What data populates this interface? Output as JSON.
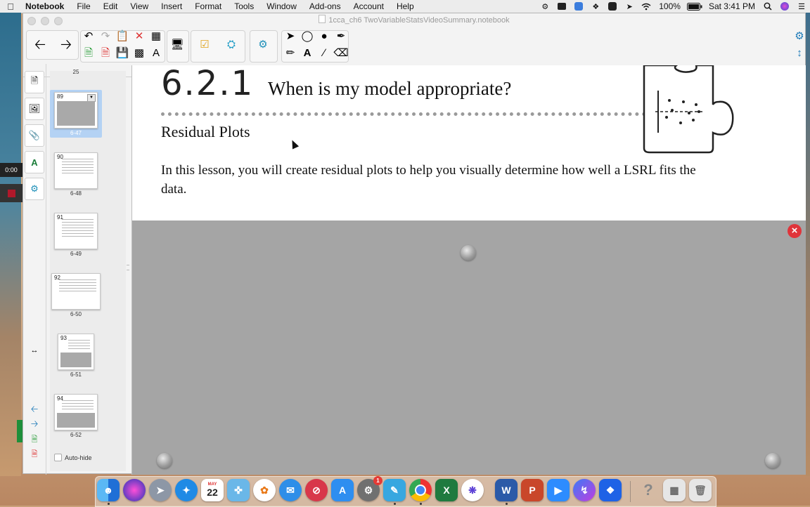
{
  "menubar": {
    "app_name": "Notebook",
    "items": [
      "File",
      "Edit",
      "View",
      "Insert",
      "Format",
      "Tools",
      "Window",
      "Add-ons",
      "Account",
      "Help"
    ],
    "battery": "100%",
    "clock": "Sat 3:41 PM"
  },
  "video": {
    "time": "0:00"
  },
  "window": {
    "title": "1cca_ch6 TwoVariableStatsVideoSummary.notebook"
  },
  "sorter": {
    "top_partial_label": "25",
    "pages": [
      {
        "number": "89",
        "label": "6-47",
        "selected": true
      },
      {
        "number": "90",
        "label": "6-48",
        "selected": false
      },
      {
        "number": "91",
        "label": "6-49",
        "selected": false
      },
      {
        "number": "92",
        "label": "6-50",
        "selected": false
      },
      {
        "number": "93",
        "label": "6-51",
        "selected": false
      },
      {
        "number": "94",
        "label": "6-52",
        "selected": false
      }
    ],
    "autohide_label": "Auto-hide"
  },
  "slide": {
    "lesson_number": "6.2.1",
    "lesson_title": "When is my model appropriate?",
    "section_title": "Residual Plots",
    "body": "In this lesson, you will create residual plots to help you visually determine how well a LSRL fits the data."
  },
  "dock": {
    "calendar_month": "MAY",
    "calendar_day": "22",
    "badge_count": "1"
  }
}
